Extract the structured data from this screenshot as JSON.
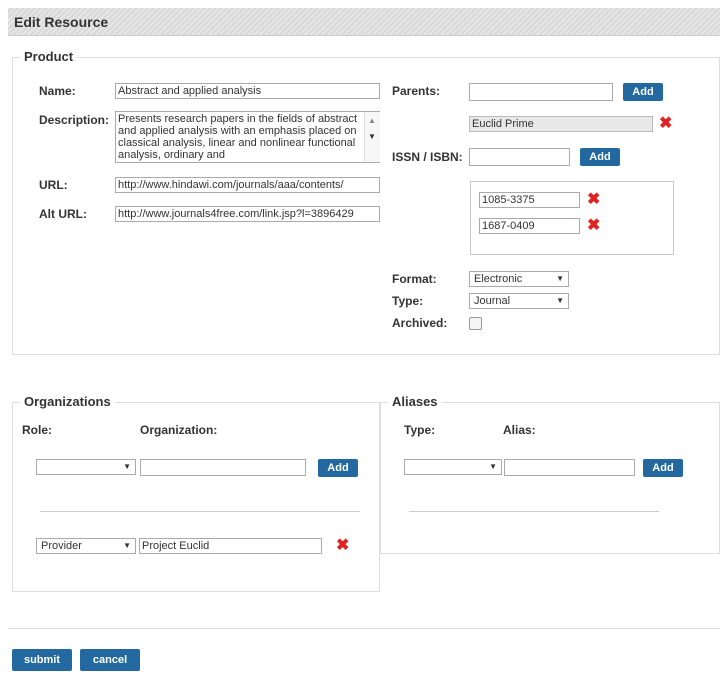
{
  "page": {
    "title": "Edit Resource"
  },
  "product": {
    "legend": "Product",
    "name_label": "Name:",
    "name_value": "Abstract and applied analysis",
    "description_label": "Description:",
    "description_value": "Presents research papers in the fields of abstract and applied analysis with an emphasis placed on classical analysis, linear and nonlinear functional analysis, ordinary and",
    "url_label": "URL:",
    "url_value": "http://www.hindawi.com/journals/aaa/contents/",
    "alt_url_label": "Alt URL:",
    "alt_url_value": "http://www.journals4free.com/link.jsp?l=3896429",
    "parents_label": "Parents:",
    "parents_value": "",
    "add_label": "Add",
    "parent_item": "Euclid Prime",
    "issn_label": "ISSN / ISBN:",
    "issn_value": "",
    "issn_items": [
      "1085-3375",
      "1687-0409"
    ],
    "format_label": "Format:",
    "format_value": "Electronic",
    "type_label": "Type:",
    "type_value": "Journal",
    "archived_label": "Archived:"
  },
  "organizations": {
    "legend": "Organizations",
    "role_label": "Role:",
    "organization_label": "Organization:",
    "role_value": "",
    "organization_value": "",
    "add_label": "Add",
    "row": {
      "role": "Provider",
      "organization": "Project Euclid"
    }
  },
  "aliases": {
    "legend": "Aliases",
    "type_label": "Type:",
    "alias_label": "Alias:",
    "type_value": "",
    "alias_value": "",
    "add_label": "Add"
  },
  "actions": {
    "submit_label": "submit",
    "cancel_label": "cancel"
  },
  "icons": {
    "delete": "x-icon",
    "dropdown": "chevron-down-icon"
  },
  "colors": {
    "button": "#2369a0",
    "delete": "#e02424"
  }
}
